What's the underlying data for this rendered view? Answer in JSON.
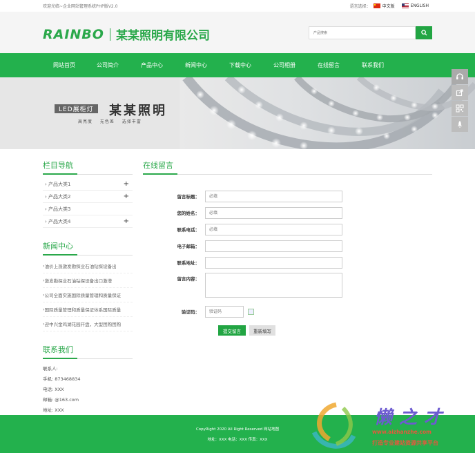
{
  "topbar": {
    "welcome": "欢迎光临~企业网站管理系统PHP版V2.0",
    "lang_label": "语言选择：",
    "lang_cn": "中文版",
    "lang_en": "ENGLISH"
  },
  "header": {
    "logo_en": "RAINBO",
    "logo_cn": "某某照明有限公司",
    "search_placeholder": "产品搜索"
  },
  "nav": {
    "items": [
      "网站首页",
      "公司简介",
      "产品中心",
      "新闻中心",
      "下载中心",
      "公司相册",
      "在线留言",
      "联系我们"
    ]
  },
  "banner": {
    "tag": "LED展柜灯",
    "title": "某某照明",
    "subtitle": "高亮度 无色差 选择丰富"
  },
  "sidebar": {
    "category_title": "栏目导航",
    "categories": [
      {
        "label": "产品大类1",
        "expand": "+"
      },
      {
        "label": "产品大类2",
        "expand": "+"
      },
      {
        "label": "产品大类3",
        "expand": ""
      },
      {
        "label": "产品大类4",
        "expand": "+"
      }
    ],
    "news_title": "新闻中心",
    "news": [
      "油价上涨激发勘探业石油钻探设备出",
      "激发勘探业石油钻探设备出口激增",
      "公司全面实施国际质量管理和质量保证",
      "国际质量管理和质量保证体系国际质量",
      "迎中兴金鸡湖花园开盘，大型团购团购"
    ],
    "contact_title": "联系我们",
    "contact": [
      "联系人:",
      "手机:  873468834",
      "电话:  XXX",
      "邮箱:  @163.com",
      "地址:  XXX"
    ]
  },
  "main": {
    "title": "在线留言",
    "form": {
      "subject_label": "留言标题：",
      "name_label": "您的姓名：",
      "phone_label": "联系电话：",
      "email_label": "电子邮箱：",
      "address_label": "联系地址：",
      "content_label": "留言内容：",
      "code_label": "验证码：",
      "required_placeholder": "必填",
      "code_placeholder": "验证码",
      "submit_label": "提交留言",
      "reset_label": "重新填写"
    }
  },
  "footer": {
    "copyright": "CopyRight 2020 All Right Reserved 网站地图",
    "contact": "地址：XXX  电话：XXX  传真：XXX"
  },
  "watermark": {
    "brand": "懒之才",
    "url": "www.aizhanzhe.com",
    "slogan": "打造专业建站资源共享平台"
  },
  "colors": {
    "brand_green": "#23b14d",
    "watermark_purple": "#6d5bd0",
    "watermark_orange": "#e8573c"
  }
}
